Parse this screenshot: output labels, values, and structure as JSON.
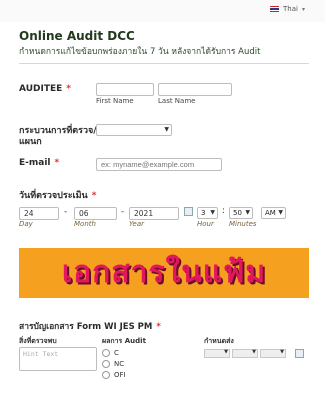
{
  "language": {
    "label": "Thai"
  },
  "header": {
    "title": "Online Audit DCC",
    "subtitle": "กำหนดการแก้ไขข้อบกพร่องภายใน 7 วัน หลังจากได้รับการ Audit"
  },
  "auditee": {
    "label": "AUDITEE",
    "required": "*",
    "first_name_label": "First Name",
    "last_name_label": "Last Name",
    "first_name_value": "",
    "last_name_value": ""
  },
  "process": {
    "label_line1": "กระบวนการที่ตรวจ/",
    "label_line2": "แผนก",
    "selected": ""
  },
  "email": {
    "label": "E-mail",
    "required": "*",
    "placeholder": "ex: myname@example.com"
  },
  "date": {
    "label": "วันที่ตรวจประเมิน",
    "required": "*",
    "day": "24",
    "month": "06",
    "year": "2021",
    "hour": "3",
    "minutes": "50",
    "ampm": "AM",
    "day_label": "Day",
    "month_label": "Month",
    "year_label": "Year",
    "hour_label": "Hour",
    "minutes_label": "Minutes",
    "sep_dash": "-",
    "sep_colon": ":"
  },
  "banner": {
    "text": "เอกสารในแฟ้ม",
    "bg_color": "#f5a11f",
    "text_color": "#e2185e"
  },
  "matrix": {
    "title": "สารบัญเอกสาร Form WI JES PM",
    "required": "*",
    "columns": [
      "สิ่งที่ตรวจพบ",
      "ผลการ Audit",
      "กำหนดส่ง"
    ],
    "textarea_placeholder": "Hint Text",
    "options": [
      "C",
      "NC",
      "OFI"
    ]
  }
}
